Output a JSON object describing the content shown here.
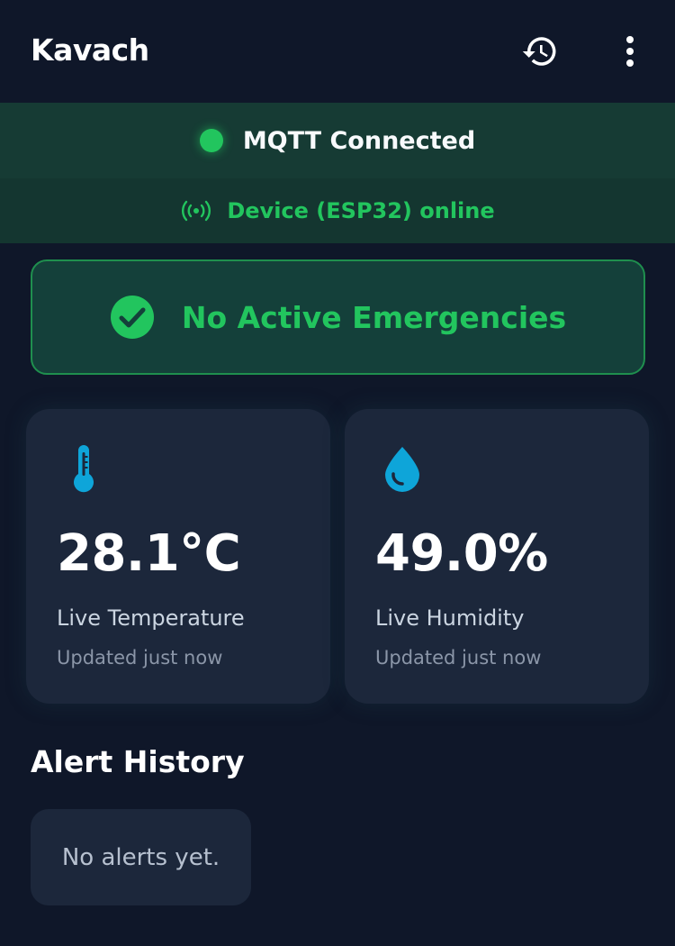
{
  "appbar": {
    "title": "Kavach",
    "history_icon": "history-icon",
    "more_icon": "more-vert-icon"
  },
  "status": {
    "mqtt_text": "MQTT Connected",
    "mqtt_color": "#22c55e",
    "device_text": "Device (ESP32) online",
    "device_icon": "broadcast-icon"
  },
  "emergency": {
    "text": "No Active Emergencies",
    "icon": "check-circle-icon",
    "accent": "#22c55e"
  },
  "sensors": [
    {
      "value": "28.1°C",
      "label": "Live Temperature",
      "updated": "Updated just now",
      "icon": "thermometer-icon",
      "icon_color": "#0ea5d9"
    },
    {
      "value": "49.0%",
      "label": "Live Humidity",
      "updated": "Updated just now",
      "icon": "water-drop-icon",
      "icon_color": "#0ea5d9"
    }
  ],
  "alerts": {
    "title": "Alert History",
    "empty_text": "No alerts yet."
  }
}
